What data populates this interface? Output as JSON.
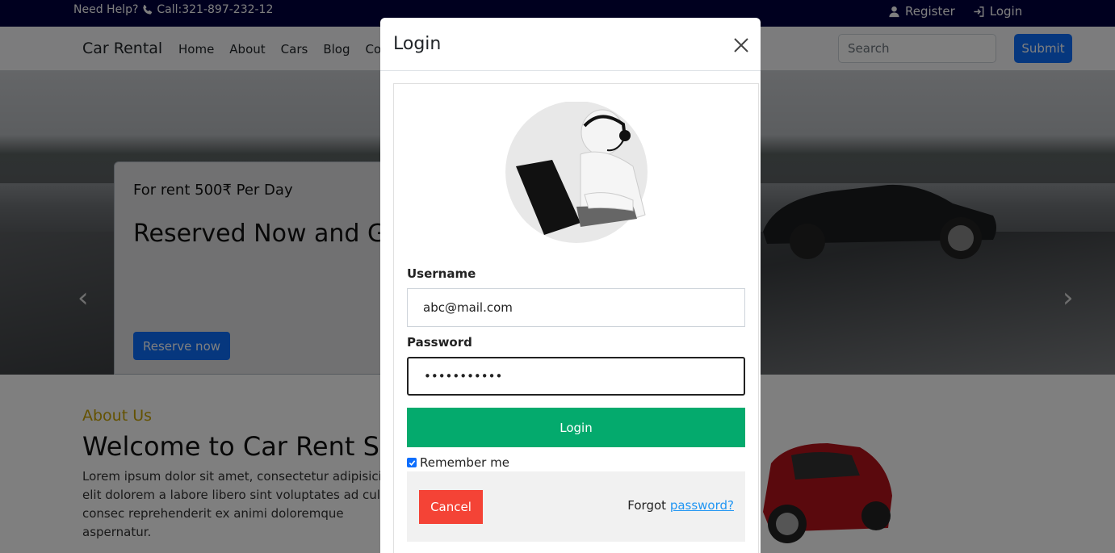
{
  "topbar": {
    "help_text": "Need Help?",
    "call_text": "Call:321-897-232-12",
    "register_label": "Register",
    "login_label": "Login"
  },
  "navbar": {
    "brand": "Car Rental",
    "links": [
      "Home",
      "About",
      "Cars",
      "Blog",
      "Cont"
    ],
    "search_placeholder": "Search",
    "submit_label": "Submit"
  },
  "hero": {
    "subtitle": "For rent 500₹ Per Day",
    "title": "Reserved Now and Get Off",
    "reserve_label": "Reserve now"
  },
  "about": {
    "label": "About Us",
    "heading": "Welcome to Car Rent Servi",
    "paragraph": "Lorem ipsum dolor sit amet, consectetur adipisicing elit dolorem a labore libero sint voluptates ad culpa consec reprehenderit ex animi doloremque aspernatur."
  },
  "modal": {
    "title": "Login",
    "username_label": "Username",
    "username_value": "abc@mail.com",
    "password_label": "Password",
    "password_value": "•••••••••••",
    "login_button": "Login",
    "remember_label": "Remember me",
    "cancel_label": "Cancel",
    "forgot_text": "Forgot",
    "forgot_link": "password?"
  },
  "colors": {
    "topbar_bg": "#00003f",
    "primary": "#0d6efd",
    "login_green": "#04aa6d",
    "cancel_red": "#f44336",
    "about_gold": "#c9a400"
  }
}
